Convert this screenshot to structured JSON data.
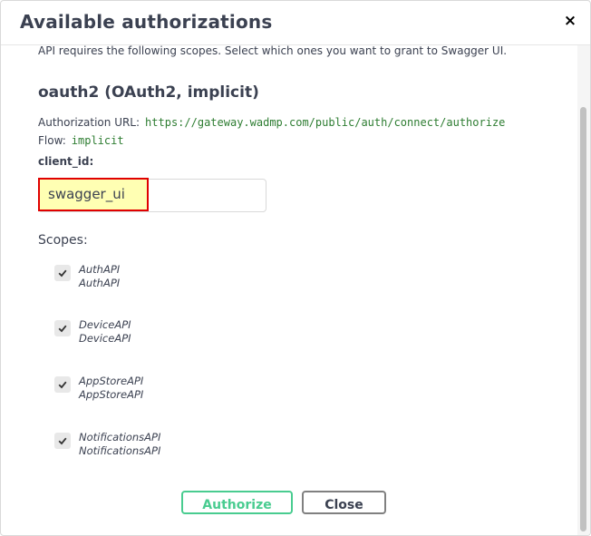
{
  "modal": {
    "title": "Available authorizations",
    "close_symbol": "×"
  },
  "auth": {
    "intro": "API requires the following scopes. Select which ones you want to grant to Swagger UI.",
    "scheme_title": "oauth2 (OAuth2, implicit)",
    "auth_url_label": "Authorization URL:",
    "auth_url_value": "https://gateway.wadmp.com/public/auth/connect/authorize",
    "flow_label": "Flow:",
    "flow_value": "implicit",
    "client_id_label": "client_id:",
    "client_id_value": "swagger_ui",
    "scopes_label": "Scopes:"
  },
  "scopes": [
    {
      "name": "AuthAPI",
      "description": "AuthAPI",
      "checked": true
    },
    {
      "name": "DeviceAPI",
      "description": "DeviceAPI",
      "checked": true
    },
    {
      "name": "AppStoreAPI",
      "description": "AppStoreAPI",
      "checked": true
    },
    {
      "name": "NotificationsAPI",
      "description": "NotificationsAPI",
      "checked": true
    }
  ],
  "buttons": {
    "authorize": "Authorize",
    "close": "Close"
  },
  "colors": {
    "authorize_border": "#49cc90",
    "highlight_border": "#e00000",
    "highlight_fill": "#ffffb3",
    "mono_text": "#2e7d32"
  },
  "icons": {
    "close": "close-icon",
    "checkbox": "checkmark-icon"
  }
}
